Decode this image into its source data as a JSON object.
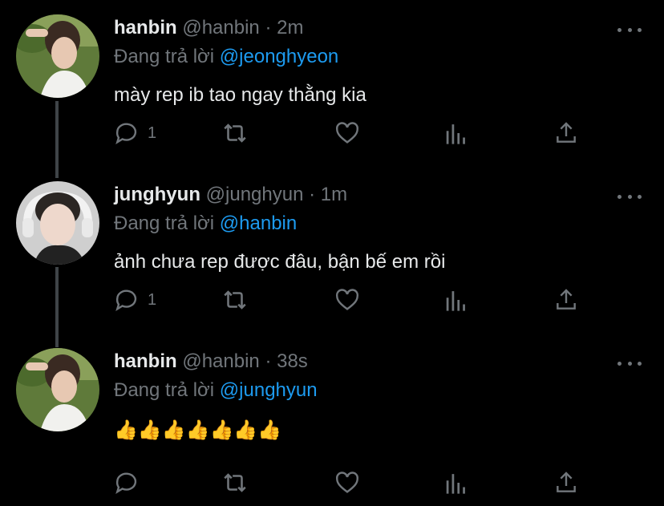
{
  "colors": {
    "background": "#000000",
    "text": "#e7e9ea",
    "muted": "#71767b",
    "accent": "#1d9bf0",
    "thread_line": "#3f4448"
  },
  "tweets": [
    {
      "name": "hanbin",
      "handle": "@hanbin",
      "separator": "·",
      "time": "2m",
      "reply_prefix": "Đang trả lời",
      "reply_to": "@jeonghyeon",
      "text": "mày rep ib tao ngay thằng kia",
      "reply_count": "1"
    },
    {
      "name": "junghyun",
      "handle": "@junghyun",
      "separator": "·",
      "time": "1m",
      "reply_prefix": "Đang trả lời",
      "reply_to": "@hanbin",
      "text": "ảnh chưa rep được đâu, bận bế em rồi",
      "reply_count": "1"
    },
    {
      "name": "hanbin",
      "handle": "@hanbin",
      "separator": "·",
      "time": "38s",
      "reply_prefix": "Đang trả lời",
      "reply_to": "@junghyun",
      "text": "👍👍👍👍👍👍👍",
      "reply_count": ""
    }
  ],
  "icons": [
    "reply-icon",
    "retweet-icon",
    "like-icon",
    "analytics-icon",
    "share-icon",
    "more-icon",
    "thumbs-up-icon"
  ]
}
